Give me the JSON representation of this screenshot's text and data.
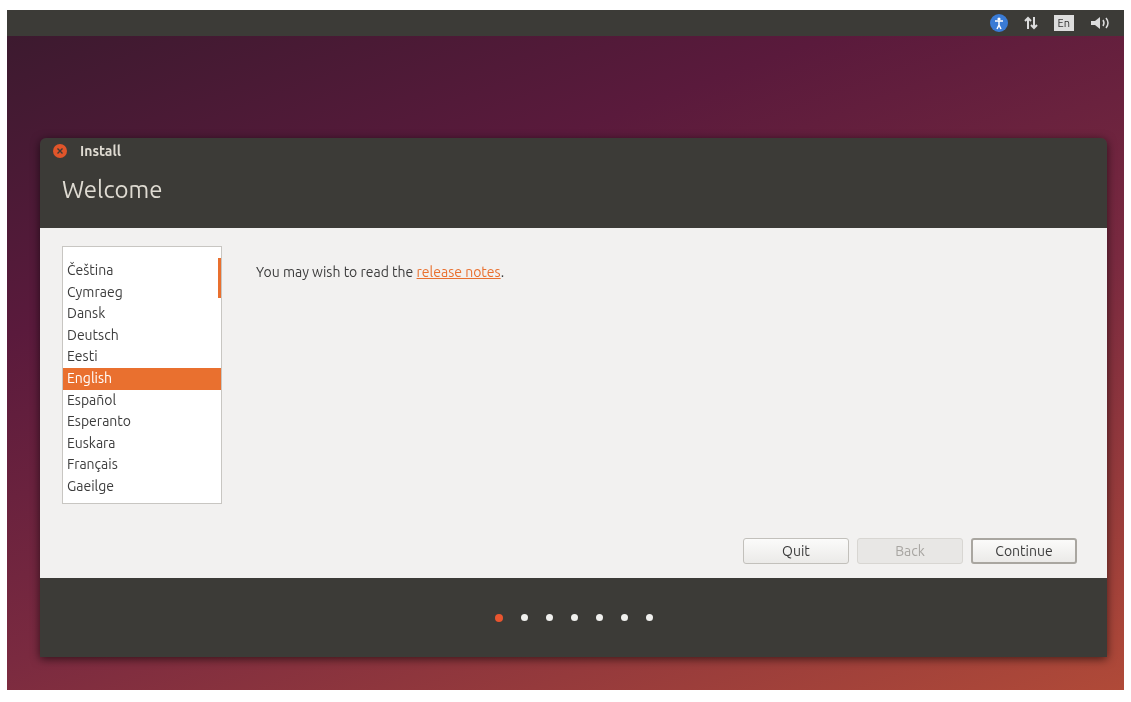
{
  "top_panel": {
    "keyboard_layout": "En"
  },
  "window": {
    "title": "Install",
    "heading": "Welcome"
  },
  "languages": [
    {
      "label": "Čeština",
      "selected": false
    },
    {
      "label": "Cymraeg",
      "selected": false
    },
    {
      "label": "Dansk",
      "selected": false
    },
    {
      "label": "Deutsch",
      "selected": false
    },
    {
      "label": "Eesti",
      "selected": false
    },
    {
      "label": "English",
      "selected": true
    },
    {
      "label": "Español",
      "selected": false
    },
    {
      "label": "Esperanto",
      "selected": false
    },
    {
      "label": "Euskara",
      "selected": false
    },
    {
      "label": "Français",
      "selected": false
    },
    {
      "label": "Gaeilge",
      "selected": false
    }
  ],
  "notes": {
    "text": "You may wish to read the ",
    "link": "release notes",
    "after": "."
  },
  "buttons": [
    {
      "label": "Quit",
      "disabled": false,
      "default": false
    },
    {
      "label": "Back",
      "disabled": true,
      "default": false
    },
    {
      "label": "Continue",
      "disabled": false,
      "default": true
    }
  ],
  "steps": [
    {
      "selected": true
    },
    {
      "selected": false
    },
    {
      "selected": false
    },
    {
      "selected": false
    },
    {
      "selected": false
    },
    {
      "selected": false
    },
    {
      "selected": false
    }
  ]
}
